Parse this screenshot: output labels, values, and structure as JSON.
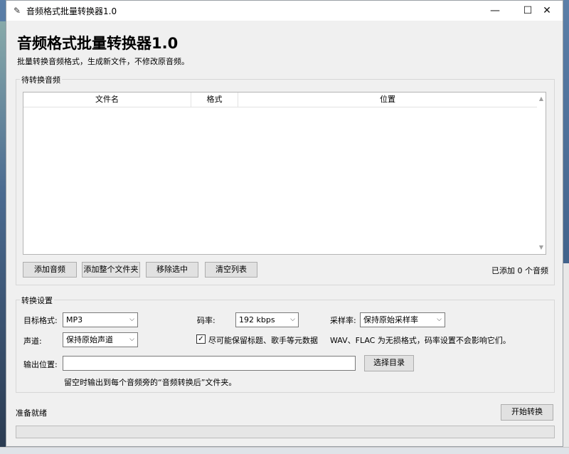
{
  "window": {
    "title": "音频格式批量转换器1.0",
    "controls": {
      "minimize": "—",
      "maximize": "☐",
      "close": "✕"
    }
  },
  "header": {
    "title": "音频格式批量转换器1.0",
    "subtitle": "批量转换音频格式，生成新文件，不修改原音频。"
  },
  "queue": {
    "group_label": "待转换音频",
    "columns": [
      "文件名",
      "格式",
      "位置"
    ],
    "rows": [],
    "buttons": {
      "add_audio": "添加音频",
      "add_folder": "添加整个文件夹",
      "remove_selected": "移除选中",
      "clear_list": "清空列表"
    },
    "count_text": "已添加 0 个音频"
  },
  "settings": {
    "group_label": "转换设置",
    "target_format_label": "目标格式:",
    "target_format_value": "MP3",
    "bitrate_label": "码率:",
    "bitrate_value": "192 kbps",
    "samplerate_label": "采样率:",
    "samplerate_value": "保持原始采样率",
    "channels_label": "声道:",
    "channels_value": "保持原始声道",
    "keep_metadata_checked": true,
    "keep_metadata_label": "尽可能保留标题、歌手等元数据",
    "lossless_note": "WAV、FLAC 为无损格式，码率设置不会影响它们。",
    "output_label": "输出位置:",
    "output_value": "",
    "choose_dir_button": "选择目录",
    "output_hint": "留空时输出到每个音频旁的“音频转换后”文件夹。"
  },
  "footer": {
    "status": "准备就绪",
    "start_button": "开始转换",
    "progress": 0
  }
}
